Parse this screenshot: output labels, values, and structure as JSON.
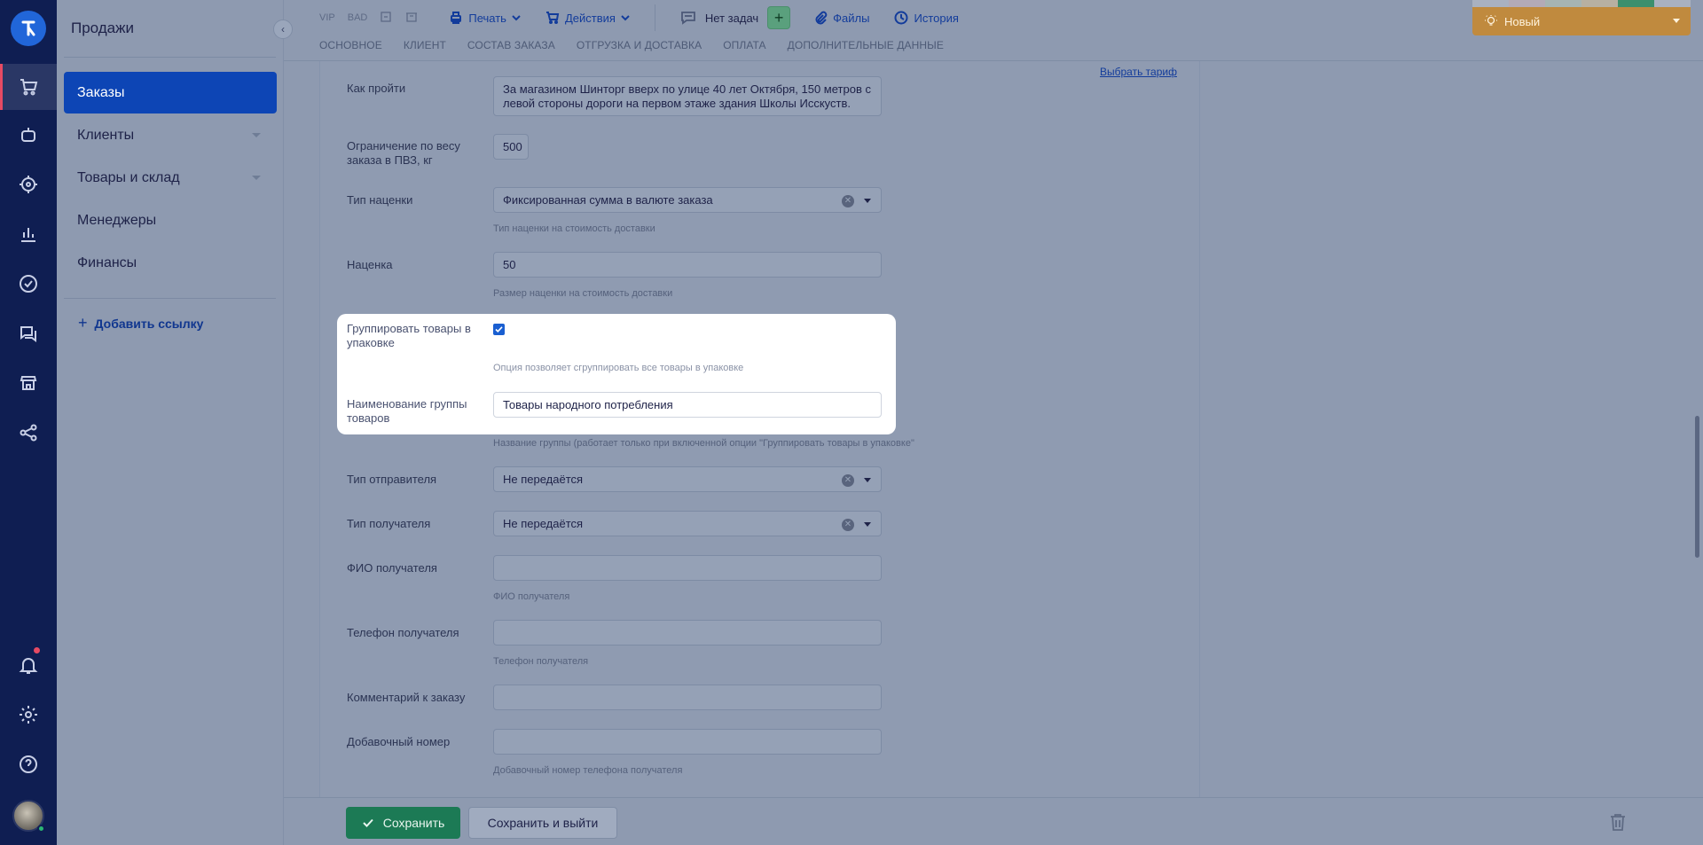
{
  "sidebar": {
    "section_title": "Продажи",
    "items": [
      {
        "label": "Заказы",
        "active": true
      },
      {
        "label": "Клиенты",
        "expandable": true
      },
      {
        "label": "Товары и склад",
        "expandable": true
      },
      {
        "label": "Менеджеры"
      },
      {
        "label": "Финансы"
      }
    ],
    "add_link": "Добавить ссылку"
  },
  "rail_icons": [
    "logo-icon",
    "cart-icon",
    "bot-icon",
    "target-icon",
    "analytics-icon",
    "tasks-icon",
    "chat-icon",
    "store-icon",
    "integrations-icon",
    "bell-icon",
    "settings-icon",
    "help-icon"
  ],
  "toolbar": {
    "vip": "VIP",
    "bad": "BAD",
    "print": "Печать",
    "actions": "Действия",
    "tasks": "Нет задач",
    "add_task": "+",
    "files": "Файлы",
    "history": "История"
  },
  "status": {
    "label": "Новый",
    "color": "#c08a3e"
  },
  "tabs": [
    "Основное",
    "Клиент",
    "Состав заказа",
    "Отгрузка и доставка",
    "Оплата",
    "Дополнительные данные"
  ],
  "form": {
    "tariff_link": "Выбрать тариф",
    "how_to_get": {
      "label": "Как пройти",
      "value": "За магазином Шинторг вверх по улице 40 лет Октября, 150 метров с левой стороны дороги на первом этаже здания Школы Исскуств."
    },
    "weight_limit": {
      "label": "Ограничение по весу заказа в ПВЗ, кг",
      "value": "500"
    },
    "markup_type": {
      "label": "Тип наценки",
      "value": "Фиксированная сумма в валюте заказа",
      "hint": "Тип наценки на стоимость доставки"
    },
    "markup": {
      "label": "Наценка",
      "value": "50",
      "hint": "Размер наценки на стоимость доставки"
    },
    "group_goods": {
      "label": "Группировать товары в упаковке",
      "checked": true,
      "hint": "Опция позволяет сгруппировать все товары в упаковке"
    },
    "group_name": {
      "label": "Наименование группы товаров",
      "value": "Товары народного потребления",
      "hint": "Название группы (работает только при включенной опции \"Группировать товары в упаковке\""
    },
    "sender_type": {
      "label": "Тип отправителя",
      "value": "Не передаётся"
    },
    "recipient_type": {
      "label": "Тип получателя",
      "value": "Не передаётся"
    },
    "recipient_name": {
      "label": "ФИО получателя",
      "value": "",
      "hint": "ФИО получателя"
    },
    "recipient_phone": {
      "label": "Телефон получателя",
      "value": "",
      "hint": "Телефон получателя"
    },
    "order_comment": {
      "label": "Комментарий к заказу",
      "value": ""
    },
    "extension": {
      "label": "Добавочный номер",
      "value": "",
      "hint": "Добавочный номер телефона получателя"
    }
  },
  "footer": {
    "save": "Сохранить",
    "save_exit": "Сохранить и выйти"
  }
}
